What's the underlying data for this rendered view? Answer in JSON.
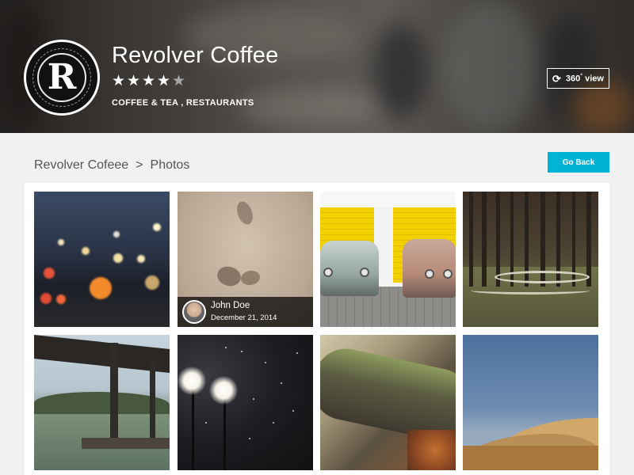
{
  "business": {
    "name": "Revolver Coffee",
    "logo_letter": "R",
    "rating": 4,
    "rating_max": 5,
    "categories": "COFFEE & TEA , RESTAURANTS",
    "view_button": {
      "icon": "refresh-icon",
      "label": "360",
      "degree": "°",
      "suffix": " view"
    }
  },
  "breadcrumb": {
    "parent": "Revolver Cofeee",
    "separator": ">",
    "current": "Photos"
  },
  "actions": {
    "go_back": "Go Back",
    "accent_color": "#00b2d6"
  },
  "photos": [
    {
      "subject": "city-night-bokeh"
    },
    {
      "subject": "sand-footprints",
      "caption": {
        "author": "John Doe",
        "date": "December 21, 2014"
      }
    },
    {
      "subject": "vintage-cars-yellow-garage"
    },
    {
      "subject": "forest-path"
    },
    {
      "subject": "river-dock"
    },
    {
      "subject": "night-lamps"
    },
    {
      "subject": "mossy-log"
    },
    {
      "subject": "desert-dunes"
    }
  ]
}
